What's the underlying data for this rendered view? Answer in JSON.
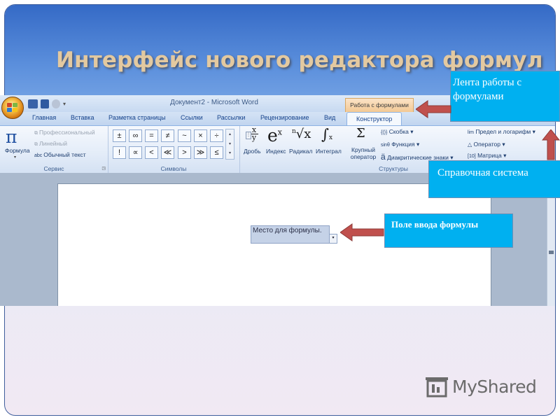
{
  "slide": {
    "title": "Интерфейс нового редактора формул",
    "logo_text": "MyShared"
  },
  "word": {
    "window_title": "Документ2 - Microsoft Word",
    "contextual_tab": "Работа с формулами",
    "tabs": [
      "Главная",
      "Вставка",
      "Разметка страницы",
      "Ссылки",
      "Рассылки",
      "Рецензирование",
      "Вид",
      "Конструктор"
    ],
    "active_tab": "Конструктор",
    "service_group": {
      "label": "Сервис",
      "formula_button": "Формула",
      "options": [
        "Профессиональный",
        "Линейный",
        "Обычный текст"
      ]
    },
    "symbols_group": {
      "label": "Символы",
      "symbols": [
        "±",
        "∞",
        "=",
        "≠",
        "~",
        "×",
        "÷",
        "!",
        "∝",
        "<",
        "≪",
        ">",
        "≫",
        "≤"
      ]
    },
    "structures_group": {
      "label": "Структуры",
      "large_items": [
        {
          "label": "Дробь",
          "glyph": "x/y"
        },
        {
          "label": "Индекс",
          "glyph": "eˣ"
        },
        {
          "label": "Радикал",
          "glyph": "ⁿ√x"
        },
        {
          "label": "Интеграл",
          "glyph": "∫"
        },
        {
          "label": "Крупный оператор",
          "glyph": "Σ"
        }
      ],
      "small_items": [
        "Скобка",
        "Функция",
        "Диакритические знаки",
        "Предел и логарифм",
        "Оператор",
        "Матрица"
      ],
      "small_icons": [
        "{()}",
        "sinθ",
        "ä",
        "lim",
        "△",
        "[10]"
      ]
    },
    "equation_placeholder": "Место для формулы."
  },
  "callouts": {
    "ribbon": "Лента работы с формулами",
    "help": "Справочная система",
    "input_field": "Поле ввода формулы"
  },
  "colors": {
    "callout_bg": "#00b0f0",
    "arrow": "#c0504d",
    "title": "#e3c9a0"
  }
}
